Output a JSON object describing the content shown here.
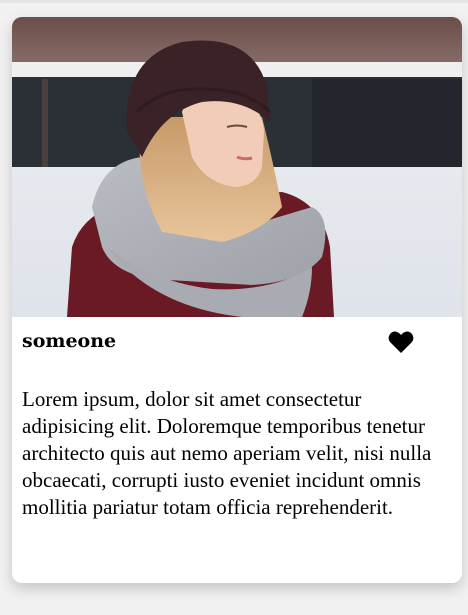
{
  "post": {
    "username": "someone",
    "description": "Lorem ipsum, dolor sit amet consectetur adipisicing elit. Doloremque temporibus tenetur architecto quis aut nemo aperiam velit, nisi nulla obcaecati, corrupti iusto eveniet incidunt omnis mollitia pariatur totam officia reprehenderit.",
    "like_icon": "heart-icon",
    "photo": "woman-in-winter-hat-and-scarf-photo"
  },
  "colors": {
    "card_background": "#ffffff",
    "page_background": "#f1f1f1",
    "heart": "#000000"
  }
}
